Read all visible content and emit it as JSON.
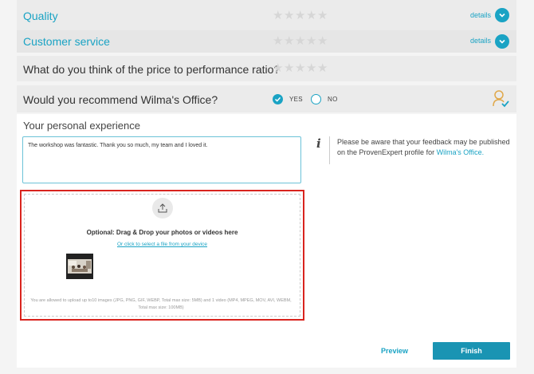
{
  "rows": [
    {
      "label": "Quality",
      "details": "details"
    },
    {
      "label": "Customer service",
      "details": "details"
    },
    {
      "label": "What do you think of the price to performance ratio?"
    },
    {
      "label": "Would you recommend Wilma's Office?"
    }
  ],
  "recommend": {
    "yes_label": "YES",
    "no_label": "NO",
    "selected": "YES"
  },
  "experience": {
    "title": "Your personal experience",
    "text": "The workshop was fantastic. Thank you so much, my team and I loved it."
  },
  "dropzone": {
    "title": "Optional: Drag & Drop your photos or videos here",
    "link": "Or click to select a file from your device",
    "note": "You are allowed to upload up to10 images (JPG, PNG, GIF, WEBP, Total max size: 5MB) and 1 video (MP4, MPEG, MOV, AVI, WEBM, Total max size: 100MB)"
  },
  "info": {
    "text": "Please be aware that your feedback may be published on the ProvenExpert profile for ",
    "link": "Wilma's Office."
  },
  "actions": {
    "preview": "Preview",
    "finish": "Finish"
  },
  "colors": {
    "accent": "#1aa3c4",
    "highlight": "#d9241e"
  }
}
